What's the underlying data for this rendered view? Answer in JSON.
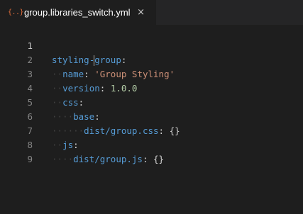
{
  "tab": {
    "icon": "{..}",
    "title": "group.libraries_switch.yml",
    "close": "×"
  },
  "lines": [
    {
      "num": "1",
      "key": "styling",
      "key2": "group",
      "sep": ":"
    },
    {
      "num": "2",
      "key": "name",
      "sep": ": ",
      "value": "'Group Styling'"
    },
    {
      "num": "3",
      "key": "version",
      "sep": ": ",
      "value": "1.0.0"
    },
    {
      "num": "4",
      "key": "css",
      "sep": ":"
    },
    {
      "num": "5",
      "key": "base",
      "sep": ":"
    },
    {
      "num": "6",
      "key": "dist/group.css",
      "sep": ": ",
      "value": "{}"
    },
    {
      "num": "7",
      "key": "js",
      "sep": ":"
    },
    {
      "num": "8",
      "key": "dist/group.js",
      "sep": ": ",
      "value": "{}"
    },
    {
      "num": "9"
    }
  ],
  "colors": {
    "key": "#569cd6",
    "string": "#ce9178",
    "number": "#b5cea8",
    "background": "#1e1e1e",
    "icon": "#e06c3a"
  },
  "icons": {
    "tab_icon": "yaml-file-icon",
    "close": "close-icon"
  }
}
